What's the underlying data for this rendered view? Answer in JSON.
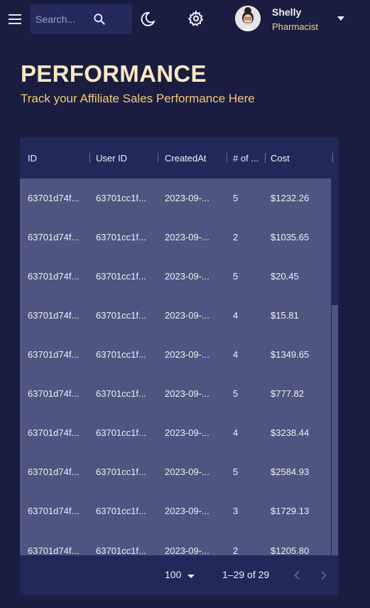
{
  "topbar": {
    "search_placeholder": "Search...",
    "user": {
      "name": "Shelly",
      "role": "Pharmacist"
    }
  },
  "header": {
    "title": "PERFORMANCE",
    "subtitle": "Track your Affiliate Sales Performance Here"
  },
  "grid": {
    "columns": [
      "ID",
      "User ID",
      "CreatedAt",
      "# of ...",
      "Cost"
    ],
    "rows": [
      [
        "63701d74f...",
        "63701cc1f...",
        "2023-09-...",
        "5",
        "$1232.26"
      ],
      [
        "63701d74f...",
        "63701cc1f...",
        "2023-09-...",
        "2",
        "$1035.65"
      ],
      [
        "63701d74f...",
        "63701cc1f...",
        "2023-09-...",
        "5",
        "$20.45"
      ],
      [
        "63701d74f...",
        "63701cc1f...",
        "2023-09-...",
        "4",
        "$15.81"
      ],
      [
        "63701d74f...",
        "63701cc1f...",
        "2023-09-...",
        "4",
        "$1349.65"
      ],
      [
        "63701d74f...",
        "63701cc1f...",
        "2023-09-...",
        "5",
        "$777.82"
      ],
      [
        "63701d74f...",
        "63701cc1f...",
        "2023-09-...",
        "4",
        "$3238.44"
      ],
      [
        "63701d74f...",
        "63701cc1f...",
        "2023-09-...",
        "5",
        "$2584.93"
      ],
      [
        "63701d74f...",
        "63701cc1f...",
        "2023-09-...",
        "3",
        "$1729.13"
      ],
      [
        "63701d74f...",
        "63701cc1f...",
        "2023-09-...",
        "2",
        "$1205.80"
      ]
    ],
    "footer": {
      "page_size": "100",
      "range": "1–29 of 29"
    }
  },
  "colors": {
    "background": "#1a1d40",
    "panel": "#21295a",
    "rows": "#4d5580",
    "title": "#fbe7c1",
    "accent": "#f3c97d"
  },
  "icons": [
    "menu-icon",
    "search-icon",
    "moon-icon",
    "gear-icon",
    "chevron-down-icon",
    "chevron-left-icon",
    "chevron-right-icon"
  ]
}
